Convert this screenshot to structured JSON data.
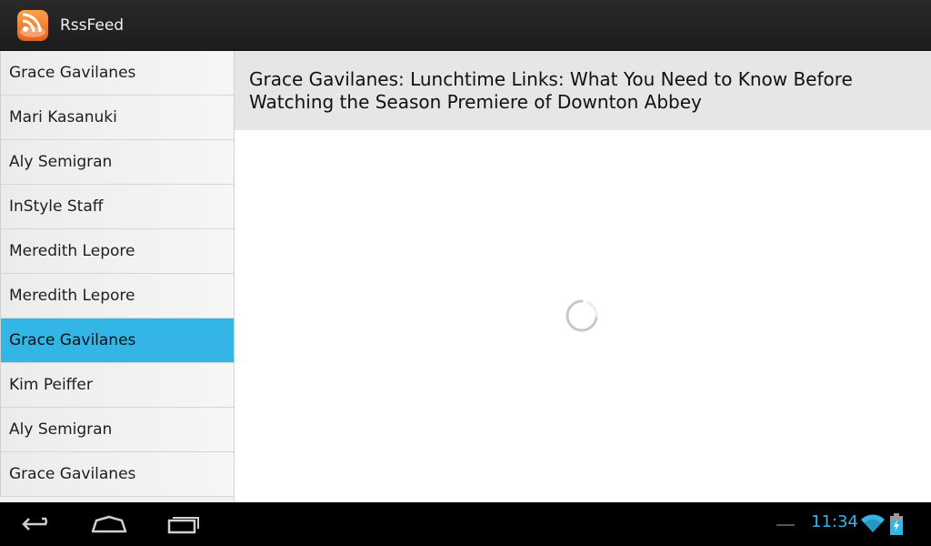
{
  "app": {
    "title": "RssFeed"
  },
  "sidebar": {
    "items": [
      {
        "label": "Grace Gavilanes",
        "selected": false
      },
      {
        "label": "Mari Kasanuki",
        "selected": false
      },
      {
        "label": "Aly Semigran",
        "selected": false
      },
      {
        "label": "InStyle Staff",
        "selected": false
      },
      {
        "label": "Meredith Lepore",
        "selected": false
      },
      {
        "label": "Meredith Lepore",
        "selected": false
      },
      {
        "label": "Grace Gavilanes",
        "selected": true
      },
      {
        "label": "Kim Peiffer",
        "selected": false
      },
      {
        "label": "Aly Semigran",
        "selected": false
      },
      {
        "label": "Grace Gavilanes",
        "selected": false
      }
    ]
  },
  "detail": {
    "title": "Grace Gavilanes: Lunchtime Links: What You Need to Know Before Watching the Season Premiere of Downton Abbey",
    "loading": true
  },
  "status_bar": {
    "time": "11:34"
  },
  "icons": {
    "app": "rss-icon",
    "back": "back-icon",
    "home": "home-icon",
    "recent": "recent-apps-icon",
    "wifi": "wifi-icon",
    "battery": "battery-charging-icon"
  },
  "colors": {
    "accent": "#33b5e5",
    "app_icon": "#f47b20"
  }
}
